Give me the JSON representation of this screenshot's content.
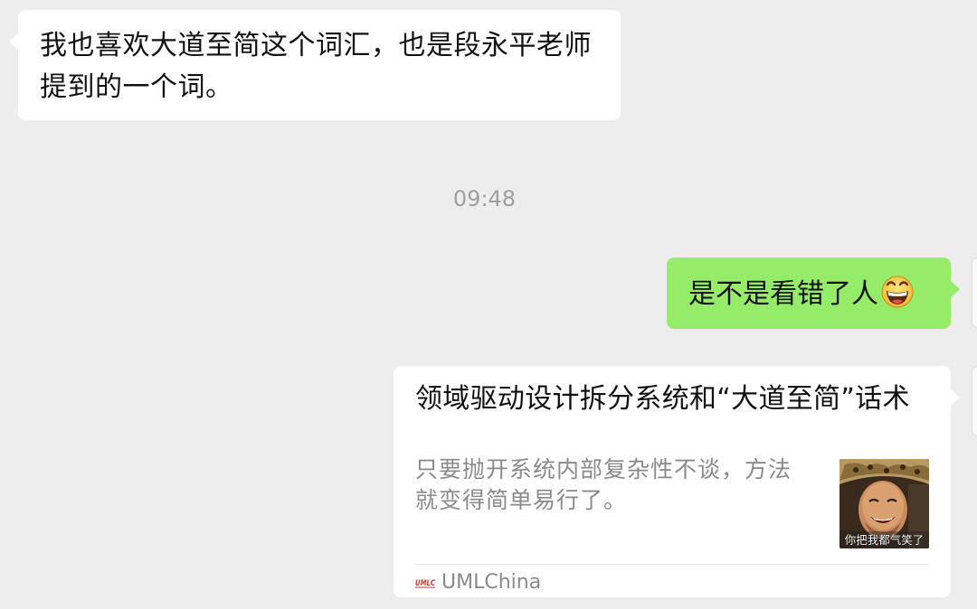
{
  "chat": {
    "incoming_message": "我也喜欢大道至简这个词汇，也是段永平老师提到的一个词。",
    "timestamp": "09:48",
    "outgoing_message": "是不是看错了人",
    "outgoing_emoji": "grinning-face-emoji"
  },
  "link_card": {
    "title": "领域驱动设计拆分系统和“大道至简”话术",
    "description": "只要抛开系统内部复杂性不谈，方法就变得简单易行了。",
    "thumbnail_caption": "你把我都气笑了",
    "source_logo_text": "UMLC",
    "source_name": "UMLChina"
  },
  "colors": {
    "background": "#ededed",
    "outgoing_bubble": "#95ec69",
    "incoming_bubble": "#ffffff",
    "logo_red": "#d9332b"
  }
}
